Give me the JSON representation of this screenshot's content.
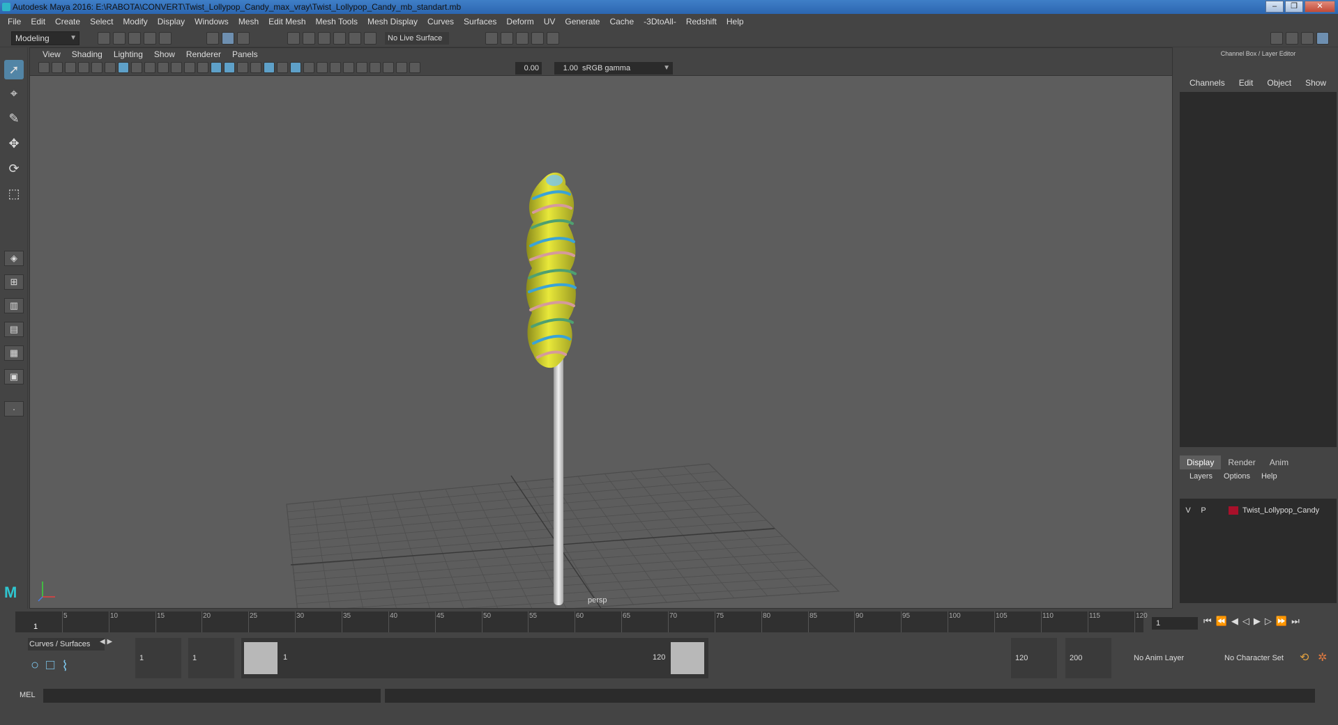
{
  "window": {
    "title": "Autodesk Maya 2016: E:\\RABOTA\\CONVERT\\Twist_Lollypop_Candy_max_vray\\Twist_Lollypop_Candy_mb_standart.mb",
    "min_label": "–",
    "max_label": "❐",
    "close_label": "✕"
  },
  "menubar": [
    "File",
    "Edit",
    "Create",
    "Select",
    "Modify",
    "Display",
    "Windows",
    "Mesh",
    "Edit Mesh",
    "Mesh Tools",
    "Mesh Display",
    "Curves",
    "Surfaces",
    "Deform",
    "UV",
    "Generate",
    "Cache",
    "-3DtoAll-",
    "Redshift",
    "Help"
  ],
  "status": {
    "mode": "Modeling",
    "live_surface": "No Live Surface"
  },
  "viewport": {
    "menu": [
      "View",
      "Shading",
      "Lighting",
      "Show",
      "Renderer",
      "Panels"
    ],
    "exposure": "0.00",
    "gamma": "1.00",
    "color_space": "sRGB gamma",
    "camera_label": "persp"
  },
  "channelbox": {
    "title": "Channel Box / Layer Editor",
    "menu": [
      "Channels",
      "Edit",
      "Object",
      "Show"
    ],
    "tabs": [
      "Display",
      "Render",
      "Anim"
    ],
    "layer_menu": [
      "Layers",
      "Options",
      "Help"
    ],
    "layer": {
      "v": "V",
      "p": "P",
      "name": "Twist_Lollypop_Candy",
      "color": "#a8102a"
    }
  },
  "timeline": {
    "ticks": [
      "5",
      "10",
      "15",
      "20",
      "25",
      "30",
      "35",
      "40",
      "45",
      "50",
      "55",
      "60",
      "65",
      "70",
      "75",
      "80",
      "85",
      "90",
      "95",
      "100",
      "105",
      "110",
      "115",
      "120"
    ],
    "current_marker": "1",
    "current_frame": "1"
  },
  "range": {
    "shelf_tab": "Curves / Surfaces",
    "start_min": "1",
    "start": "1",
    "slider_start": "1",
    "slider_end": "120",
    "end": "120",
    "end_max": "200",
    "anim_layer": "No Anim Layer",
    "character_set": "No Character Set"
  },
  "cmd": {
    "mel_label": "MEL"
  }
}
